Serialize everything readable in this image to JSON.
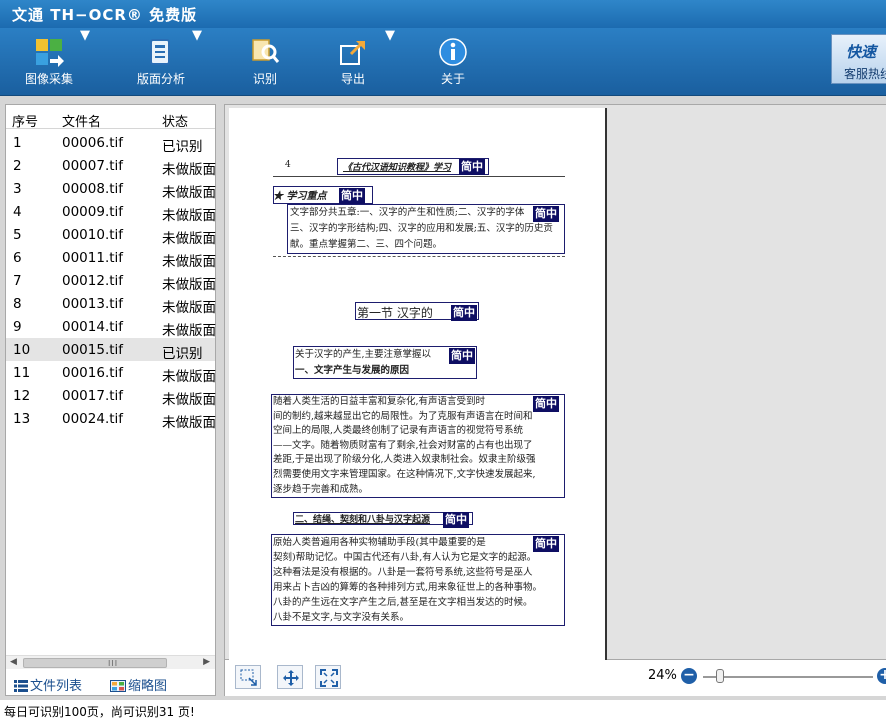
{
  "app": {
    "title": "文通 TH−OCR® 免费版"
  },
  "toolbar": {
    "items": [
      {
        "label": "图像采集",
        "icon": "image-capture-icon"
      },
      {
        "label": "版面分析",
        "icon": "layout-analysis-icon"
      },
      {
        "label": "识别",
        "icon": "recognize-icon"
      },
      {
        "label": "导出",
        "icon": "export-icon"
      },
      {
        "label": "关于",
        "icon": "info-icon"
      }
    ],
    "ad": {
      "line1": "快速",
      "line2": "客服热线"
    }
  },
  "file_list": {
    "columns": [
      "序号",
      "文件名",
      "状态"
    ],
    "rows": [
      {
        "num": "1",
        "name": "00006.tif",
        "status": "已识别"
      },
      {
        "num": "2",
        "name": "00007.tif",
        "status": "未做版面"
      },
      {
        "num": "3",
        "name": "00008.tif",
        "status": "未做版面"
      },
      {
        "num": "4",
        "name": "00009.tif",
        "status": "未做版面"
      },
      {
        "num": "5",
        "name": "00010.tif",
        "status": "未做版面"
      },
      {
        "num": "6",
        "name": "00011.tif",
        "status": "未做版面"
      },
      {
        "num": "7",
        "name": "00012.tif",
        "status": "未做版面"
      },
      {
        "num": "8",
        "name": "00013.tif",
        "status": "未做版面"
      },
      {
        "num": "9",
        "name": "00014.tif",
        "status": "未做版面"
      },
      {
        "num": "10",
        "name": "00015.tif",
        "status": "已识别"
      },
      {
        "num": "11",
        "name": "00016.tif",
        "status": "未做版面"
      },
      {
        "num": "12",
        "name": "00017.tif",
        "status": "未做版面"
      },
      {
        "num": "13",
        "name": "00024.tif",
        "status": "未做版面"
      }
    ],
    "selected_index": 9,
    "scroll_grip": "III",
    "tabs": {
      "list": "文件列表",
      "thumbs": "缩略图"
    }
  },
  "page_image": {
    "page_number": "4",
    "running_head": "《古代汉语知识教程》学习",
    "zone_tag": "简中",
    "study_heading": "★ 学习重点",
    "study_lines": [
      "文字部分共五章:一、汉字的产生和性质;二、汉字的字体",
      "三、汉字的字形结构;四、汉字的应用和发展;五、汉字的历史贡",
      "献。重点掌握第二、三、四个问题。"
    ],
    "section_title": "第一节  汉字的",
    "intro_line1": "关于汉字的产生,主要注意掌握以",
    "intro_line2": "一、文字产生与发展的原因",
    "para1": [
      "   随着人类生活的日益丰富和复杂化,有声语言受到时",
      "间的制约,越来越显出它的局限性。为了克服有声语言在时间和",
      "空间上的局限,人类最终创制了记录有声语言的视觉符号系统",
      "——文字。随着物质财富有了剩余,社会对财富的占有也出现了",
      "差距,于是出现了阶级分化,人类进入奴隶制社会。奴隶主阶级强",
      "烈需要使用文字来管理国家。在这种情况下,文字快速发展起来,",
      "逐步趋于完善和成熟。"
    ],
    "heading2": "二、结绳、契刻和八卦与汉字起源",
    "para2": [
      "   原始人类普遍用各种实物辅助手段(其中最重要的是",
      "契刻)帮助记忆。中国古代还有八卦,有人认为它是文字的起源。",
      "这种看法是没有根据的。八卦是一套符号系统,这些符号是巫人",
      "用来占卜吉凶的算筹的各种排列方式,用来象征世上的各种事物。",
      "八卦的产生远在文字产生之后,甚至是在文字相当发达的时候。",
      "八卦不是文字,与文字没有关系。"
    ]
  },
  "viewer": {
    "zoom": "24%",
    "zoom_fraction": 0.1
  },
  "status": {
    "text": "每日可识别100页，尚可识别31 页!"
  }
}
